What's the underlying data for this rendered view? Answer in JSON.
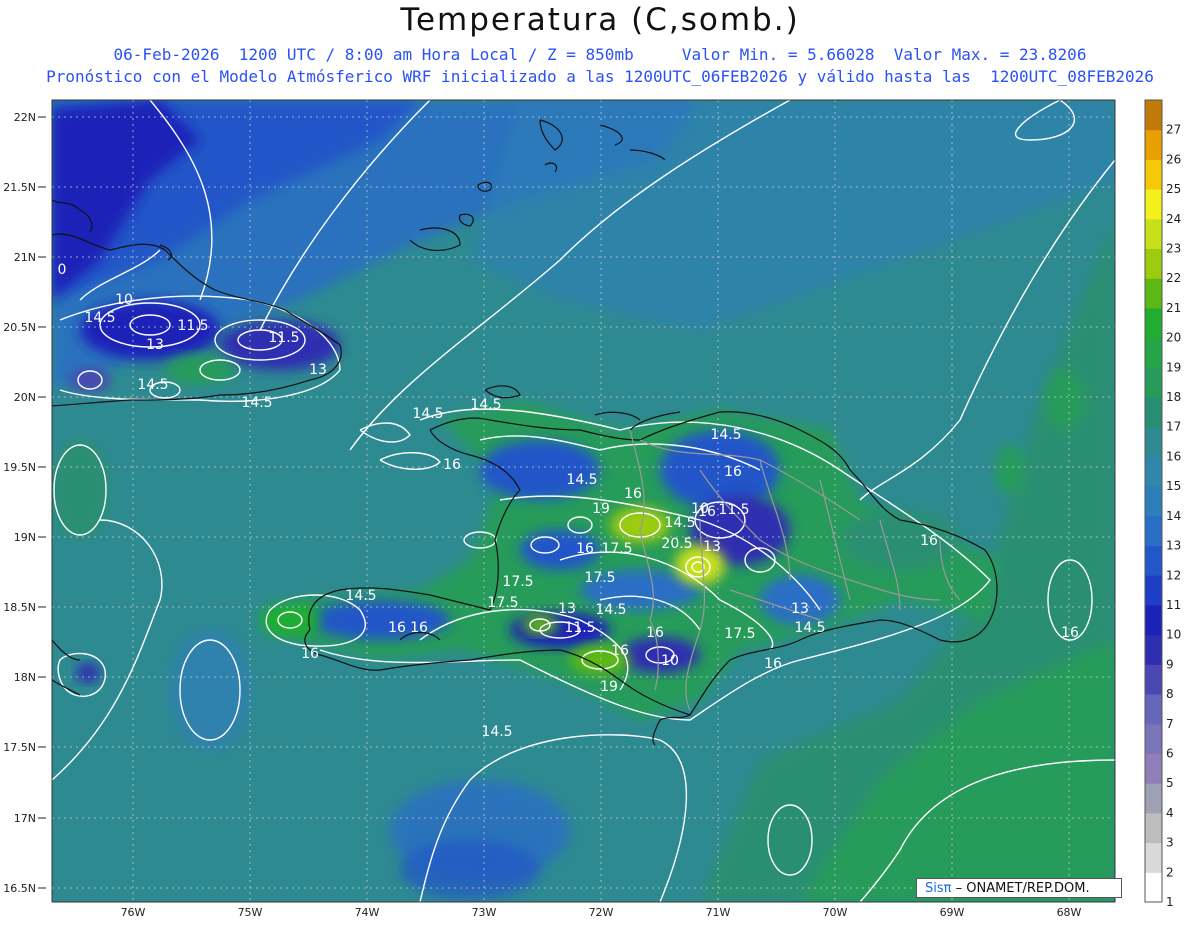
{
  "title": "Temperatura (C,somb.)",
  "subtitle1": "06-Feb-2026  1200 UTC / 8:00 am Hora Local / Z = 850mb     Valor Min. = 5.66028  Valor Max. = 23.8206",
  "subtitle2": "Pronóstico con el Modelo Atmósferico WRF inicializado a las 1200UTC_06FEB2026 y válido hasta las  1200UTC_08FEB2026",
  "lat_labels": [
    "22N",
    "21.5N",
    "21N",
    "20.5N",
    "20N",
    "19.5N",
    "19N",
    "18.5N",
    "18N",
    "17.5N",
    "17N",
    "16.5N"
  ],
  "lon_labels": [
    "76W",
    "75W",
    "74W",
    "73W",
    "72W",
    "71W",
    "70W",
    "69W",
    "68W"
  ],
  "colorbar": {
    "labels": [
      "1",
      "2",
      "3",
      "4",
      "5",
      "6",
      "7",
      "8",
      "9",
      "10",
      "11",
      "12",
      "13",
      "14",
      "15",
      "16",
      "17",
      "18",
      "19",
      "20",
      "21",
      "22",
      "23",
      "24",
      "25",
      "26",
      "27"
    ],
    "colors": [
      "#ffffff",
      "#d9d9d9",
      "#bdbdbd",
      "#a0a0b4",
      "#8e7fb8",
      "#7b74b8",
      "#6666bb",
      "#4a47b0",
      "#2e2fb0",
      "#1c21b8",
      "#1f3ec8",
      "#2157c8",
      "#2a6ec5",
      "#2d7fb9",
      "#2f88ac",
      "#2e8a91",
      "#2a8f72",
      "#269b5a",
      "#23a548",
      "#1fae30",
      "#5cb814",
      "#9ccc10",
      "#c8e01a",
      "#f2f21a",
      "#f5c80a",
      "#e8a000",
      "#c07a08"
    ]
  },
  "map_labels": [
    "0",
    "10",
    "14.5",
    "11.5",
    "13",
    "11.5",
    "13",
    "14.5",
    "14.5",
    "14.5",
    "14.5",
    "16",
    "14.5",
    "14.5",
    "16",
    "16",
    "19",
    "16",
    "10",
    "11.5",
    "14.5",
    "16",
    "20.5",
    "13",
    "17.5",
    "16",
    "16",
    "17.5",
    "17.5",
    "14.5",
    "13",
    "14.5",
    "17.5",
    "11.5",
    "16",
    "16",
    "10",
    "17.5",
    "14.5",
    "13",
    "16",
    "16",
    "19",
    "14.5",
    "16",
    "16"
  ],
  "logo_sis": "Sisπ",
  "logo_text": " – ONAMET/REP.DOM."
}
